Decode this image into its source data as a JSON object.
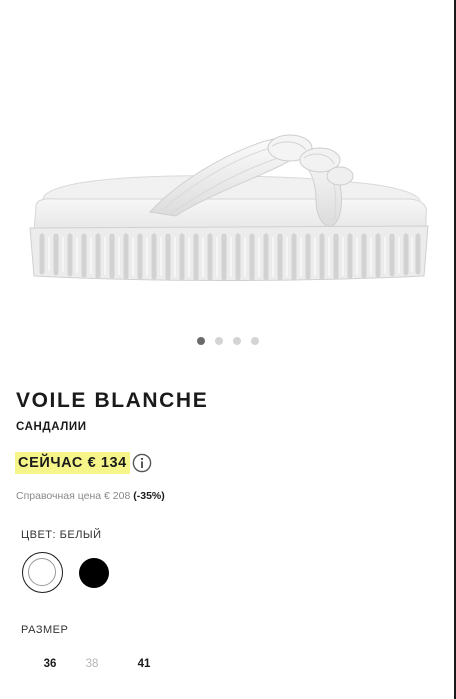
{
  "product": {
    "brand": "VOILE BLANCHE",
    "category": "САНДАЛИИ",
    "price_now": "СЕЙЧАС € 134",
    "ref_price_label": "Справочная цена",
    "ref_price_value": "€ 208",
    "discount": "(-35%)",
    "image_icon": "white-slide-sandal-image"
  },
  "gallery": {
    "total_images": 4,
    "active_index": 0
  },
  "color": {
    "label": "ЦВЕТ: БЕЛЫЙ",
    "options": [
      {
        "name": "white",
        "hex": "#ffffff",
        "selected": true
      },
      {
        "name": "black",
        "hex": "#000000",
        "selected": false
      }
    ]
  },
  "size": {
    "label": "РАЗМЕР",
    "options": [
      {
        "value": "36",
        "available": true
      },
      {
        "value": "38",
        "available": false
      },
      {
        "value": "41",
        "available": true
      }
    ]
  },
  "colors": {
    "price_highlight": "#f6f58a",
    "text": "#1a1a1a",
    "muted": "#8a8a8a"
  }
}
